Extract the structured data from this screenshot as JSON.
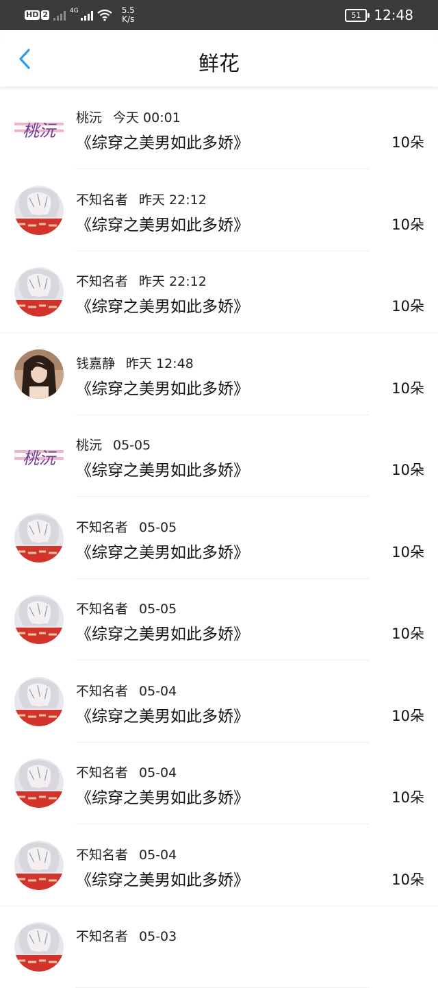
{
  "status_bar": {
    "hd_label": "HD",
    "sim_slot": "2",
    "network_type": "4G",
    "speed_value": "5.5",
    "speed_unit": "K/s",
    "battery": "51",
    "time": "12:48"
  },
  "header": {
    "title": "鲜花",
    "back_icon": "chevron-left-icon"
  },
  "colors": {
    "accent": "#2f9bf0",
    "status_bar_bg": "#3b3b3b"
  },
  "items": [
    {
      "user": "桃沅",
      "time": "今天 00:01",
      "book": "《综穿之美男如此多娇》",
      "count": "10朵",
      "avatar": "logo",
      "logo_text": "桃沅"
    },
    {
      "user": "不知名者",
      "time": "昨天 22:12",
      "book": "《综穿之美男如此多娇》",
      "count": "10朵",
      "avatar": "anime"
    },
    {
      "user": "不知名者",
      "time": "昨天 22:12",
      "book": "《综穿之美男如此多娇》",
      "count": "10朵",
      "avatar": "anime"
    },
    {
      "user": "钱嘉静",
      "time": "昨天 12:48",
      "book": "《综穿之美男如此多娇》",
      "count": "10朵",
      "avatar": "photo"
    },
    {
      "user": "桃沅",
      "time": "05-05",
      "book": "《综穿之美男如此多娇》",
      "count": "10朵",
      "avatar": "logo",
      "logo_text": "桃沅"
    },
    {
      "user": "不知名者",
      "time": "05-05",
      "book": "《综穿之美男如此多娇》",
      "count": "10朵",
      "avatar": "anime"
    },
    {
      "user": "不知名者",
      "time": "05-05",
      "book": "《综穿之美男如此多娇》",
      "count": "10朵",
      "avatar": "anime"
    },
    {
      "user": "不知名者",
      "time": "05-04",
      "book": "《综穿之美男如此多娇》",
      "count": "10朵",
      "avatar": "anime"
    },
    {
      "user": "不知名者",
      "time": "05-04",
      "book": "《综穿之美男如此多娇》",
      "count": "10朵",
      "avatar": "anime"
    },
    {
      "user": "不知名者",
      "time": "05-04",
      "book": "《综穿之美男如此多娇》",
      "count": "10朵",
      "avatar": "anime"
    },
    {
      "user": "不知名者",
      "time": "05-03",
      "book": "",
      "count": "",
      "avatar": "anime"
    }
  ]
}
